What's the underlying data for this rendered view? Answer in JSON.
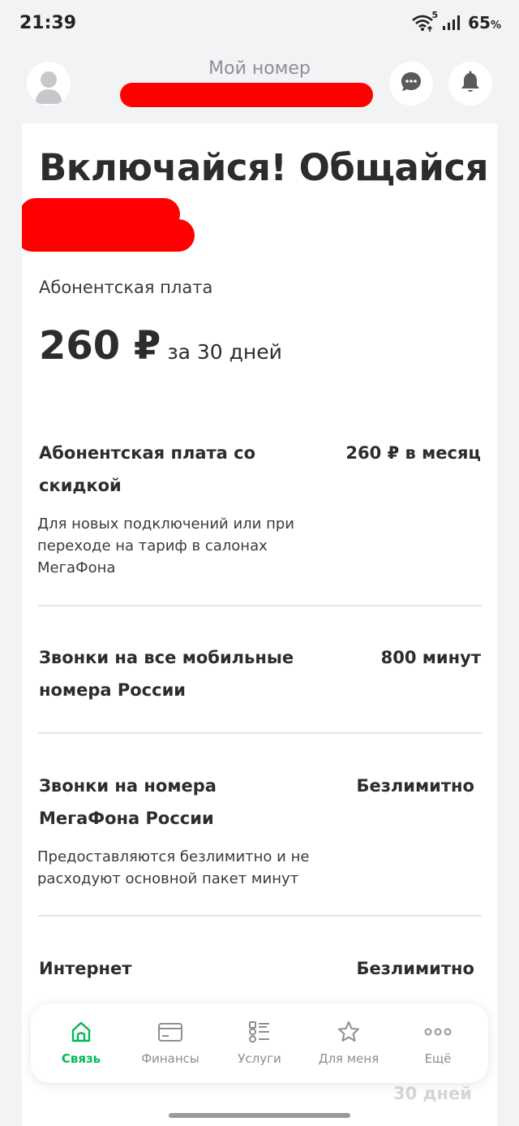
{
  "status_bar": {
    "time": "21:39",
    "network": "5",
    "battery": "65",
    "battery_unit": "%"
  },
  "header": {
    "title": "Мой номер",
    "icons": [
      "avatar-icon",
      "chat-icon",
      "bell-icon"
    ]
  },
  "tariff": {
    "title": "Включайся! Общайся",
    "fee_label": "Абонентская плата",
    "fee_amount": "260 ₽",
    "fee_period": "за 30 дней"
  },
  "features": [
    {
      "title": "Абонентская плата со скидкой",
      "value": "260 ₽ в месяц",
      "description": "Для новых подключений или при переходе на тариф в салонах МегаФона"
    },
    {
      "title": "Звонки на все мобильные номера России",
      "value": "800 минут",
      "description": ""
    },
    {
      "title": "Звонки на номера МегаФона России",
      "value": "Безлимитно",
      "description": "Предоставляются безлимитно и не расходуют основной пакет минут"
    },
    {
      "title": "Интернет",
      "value": "Безлимитно",
      "description": ""
    }
  ],
  "peek_text": "30 дней",
  "bottom_nav": [
    {
      "label": "Связь",
      "icon": "home-icon",
      "active": true
    },
    {
      "label": "Финансы",
      "icon": "card-icon",
      "active": false
    },
    {
      "label": "Услуги",
      "icon": "services-list-icon",
      "active": false
    },
    {
      "label": "Для меня",
      "icon": "star-icon",
      "active": false
    },
    {
      "label": "Ещё",
      "icon": "more-dots-icon",
      "active": false
    }
  ],
  "colors": {
    "accent": "#00b956",
    "redaction": "#ff0000",
    "background": "#f2f3f5",
    "text": "#2c2c2e",
    "muted": "#8e8e93"
  }
}
